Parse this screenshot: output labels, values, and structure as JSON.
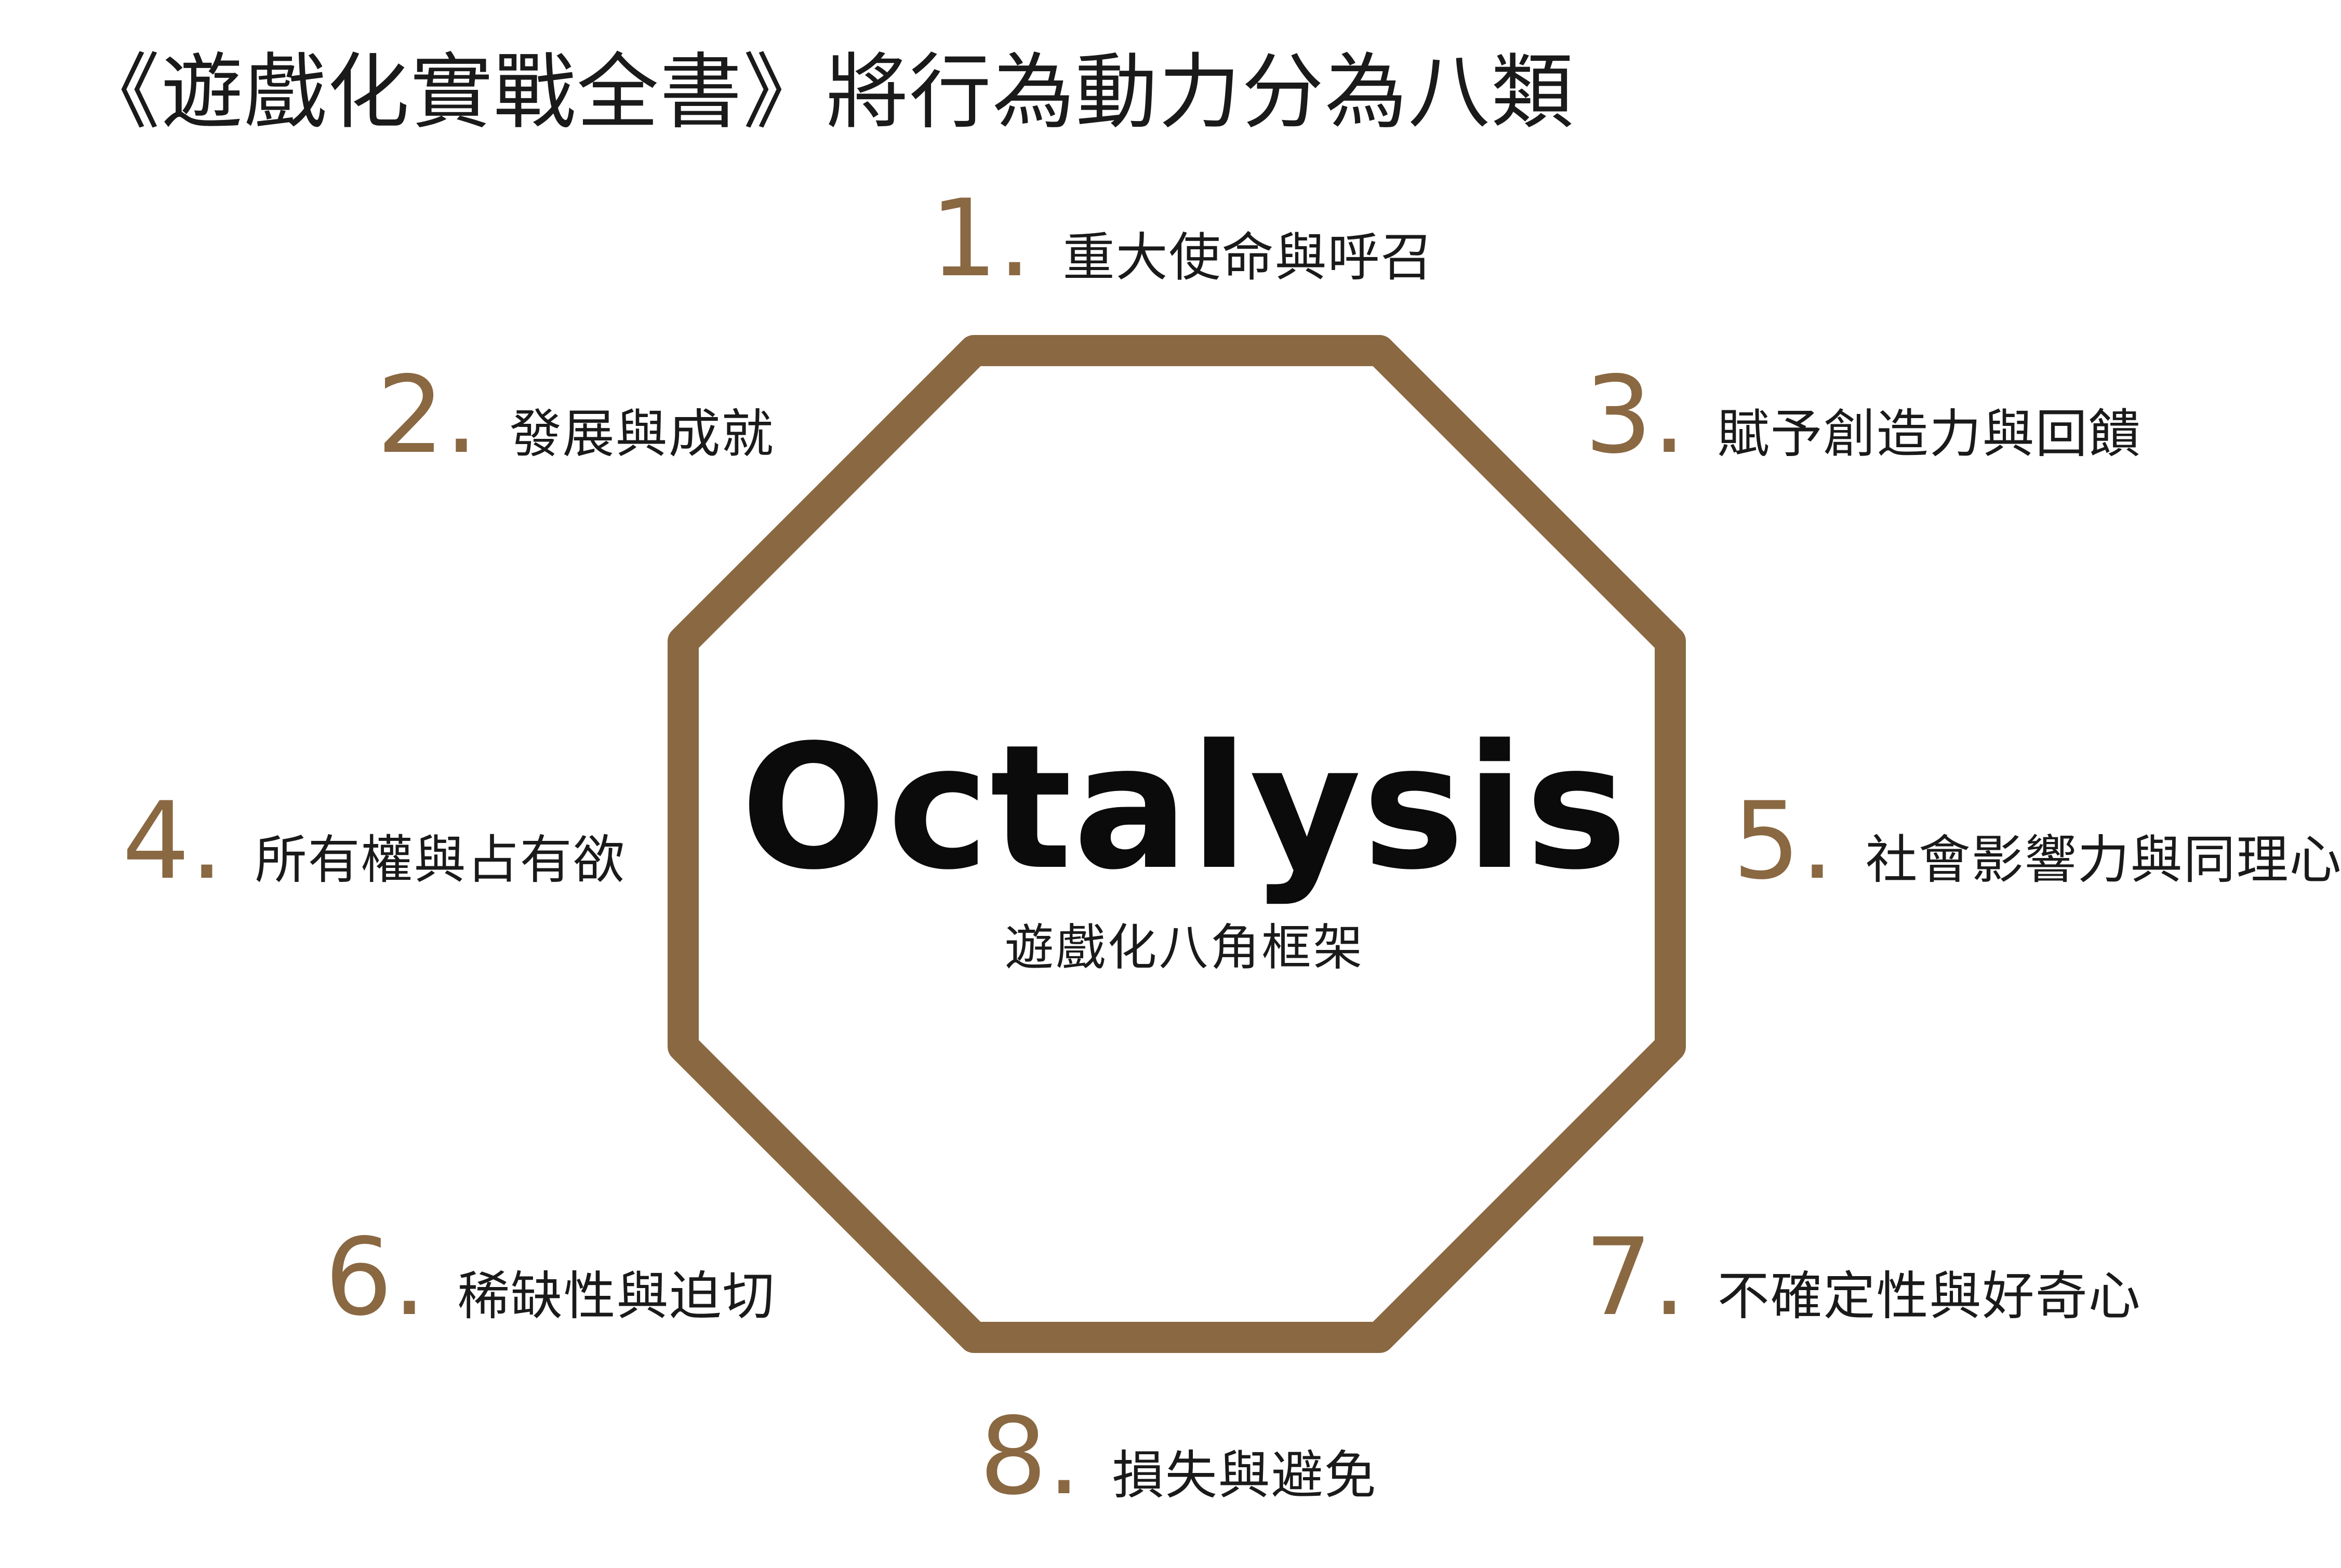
{
  "page_title": "《遊戲化實戰全書》將行為動力分為八類",
  "center": {
    "title": "Octalysis",
    "subtitle": "遊戲化八角框架"
  },
  "colors": {
    "accent": "#8a6842",
    "text": "#1a1a1a",
    "background": "#ffffff"
  },
  "drives": [
    {
      "number": "1.",
      "label": "重大使命與呼召"
    },
    {
      "number": "2.",
      "label": "發展與成就"
    },
    {
      "number": "3.",
      "label": "賦予創造力與回饋"
    },
    {
      "number": "4.",
      "label": "所有權與占有欲"
    },
    {
      "number": "5.",
      "label": "社會影響力與同理心"
    },
    {
      "number": "6.",
      "label": "稀缺性與迫切"
    },
    {
      "number": "7.",
      "label": "不確定性與好奇心"
    },
    {
      "number": "8.",
      "label": "損失與避免"
    }
  ]
}
